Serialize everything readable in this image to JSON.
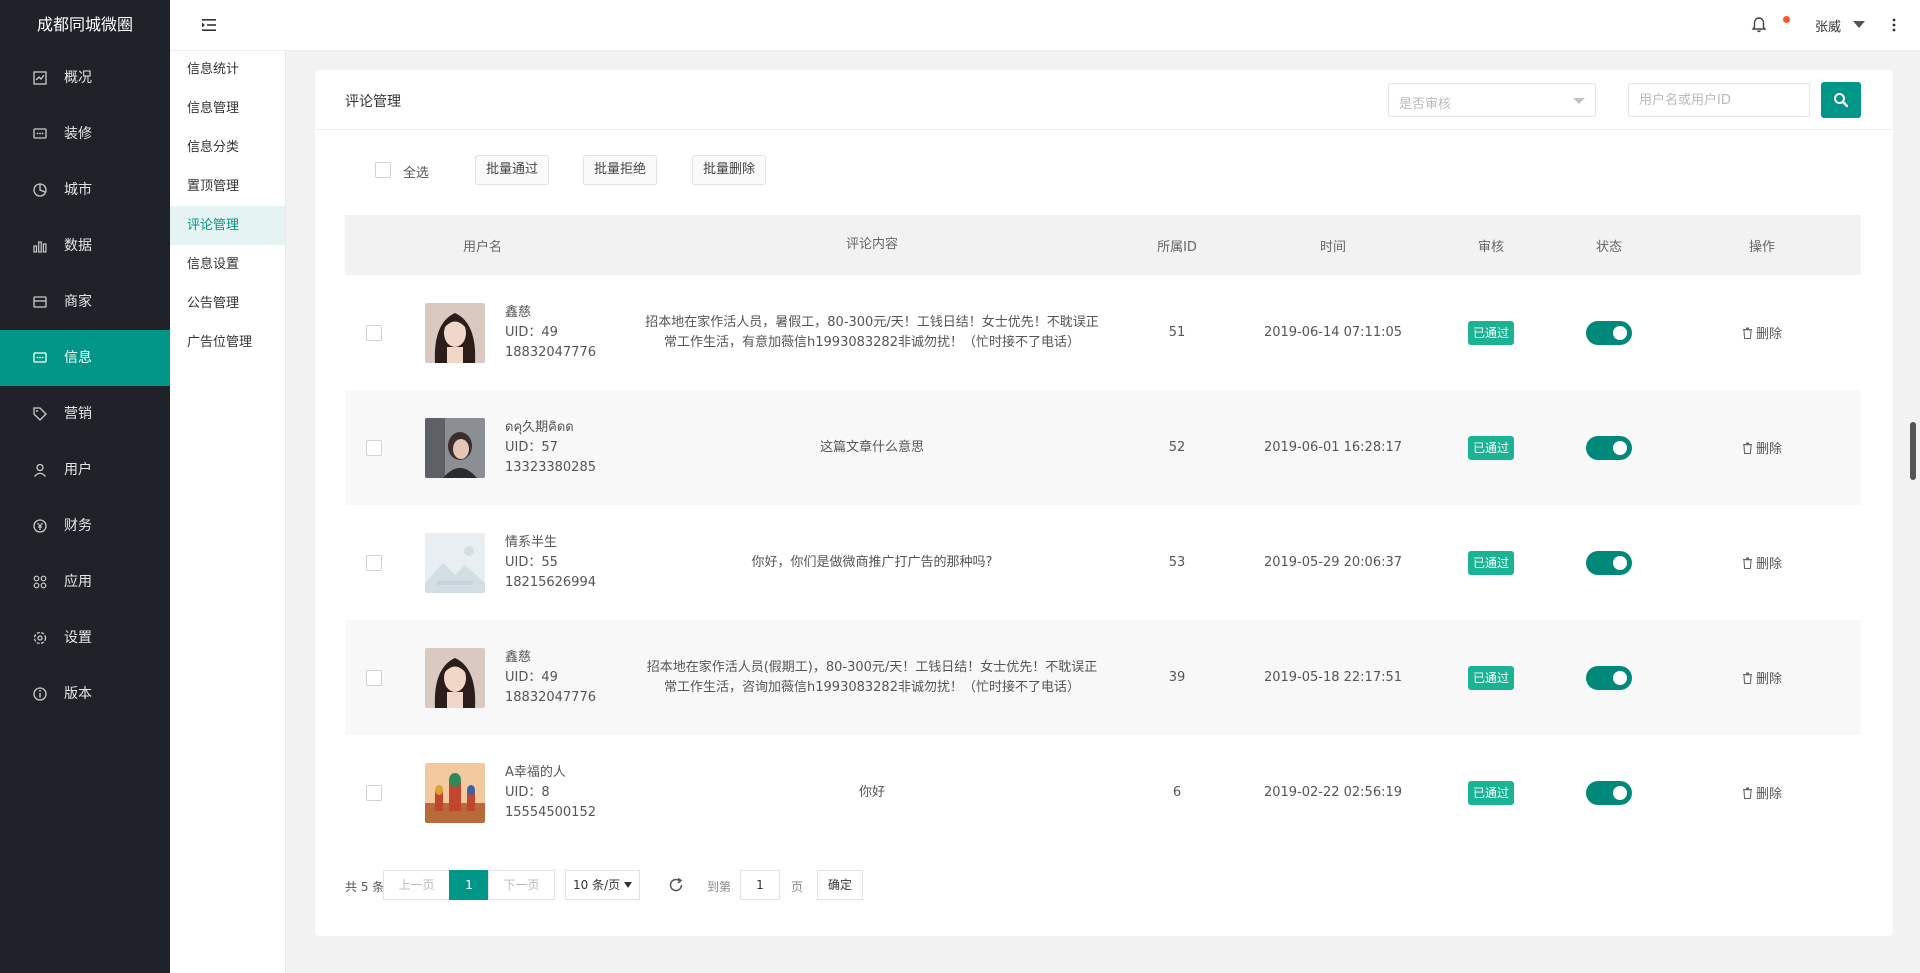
{
  "brand": "成都同城微圈",
  "nav": [
    {
      "label": "概况",
      "icon": "dashboard-icon"
    },
    {
      "label": "装修",
      "icon": "decorate-icon"
    },
    {
      "label": "城市",
      "icon": "city-icon"
    },
    {
      "label": "数据",
      "icon": "data-icon"
    },
    {
      "label": "商家",
      "icon": "merchant-icon"
    },
    {
      "label": "信息",
      "icon": "message-icon",
      "active": true
    },
    {
      "label": "营销",
      "icon": "tag-icon"
    },
    {
      "label": "用户",
      "icon": "user-icon"
    },
    {
      "label": "财务",
      "icon": "finance-icon"
    },
    {
      "label": "应用",
      "icon": "apps-icon"
    },
    {
      "label": "设置",
      "icon": "settings-icon"
    },
    {
      "label": "版本",
      "icon": "info-icon"
    }
  ],
  "submenu": [
    {
      "label": "信息统计"
    },
    {
      "label": "信息管理"
    },
    {
      "label": "信息分类"
    },
    {
      "label": "置顶管理"
    },
    {
      "label": "评论管理",
      "active": true
    },
    {
      "label": "信息设置"
    },
    {
      "label": "公告管理"
    },
    {
      "label": "广告位管理"
    }
  ],
  "header": {
    "username": "张威"
  },
  "card": {
    "title": "评论管理",
    "audit_placeholder": "是否审核",
    "search_placeholder": "用户名或用户ID"
  },
  "toolbar": {
    "select_all": "全选",
    "batch_pass": "批量通过",
    "batch_reject": "批量拒绝",
    "batch_delete": "批量删除"
  },
  "table": {
    "columns": {
      "username": "用户名",
      "content": "评论内容",
      "belong_id": "所属ID",
      "time": "时间",
      "audit": "审核",
      "status": "状态",
      "op": "操作"
    },
    "rows": [
      {
        "name": "鑫慈",
        "uid": "UID：49",
        "phone": "18832047776",
        "content": "招本地在家作活人员，暑假工，80-300元/天！工钱日结！女士优先！不耽误正常工作生活，有意加薇信h1993083282非诚勿扰！（忙时接不了电话）",
        "belong_id": "51",
        "time": "2019-06-14 07:11:05",
        "audit": "已通过",
        "delete": "删除",
        "avatar": "woman"
      },
      {
        "name": "ดคุ久期คิดด",
        "uid": "UID：57",
        "phone": "13323380285",
        "content": "这篇文章什么意思",
        "belong_id": "52",
        "time": "2019-06-01 16:28:17",
        "audit": "已通过",
        "delete": "删除",
        "avatar": "girl"
      },
      {
        "name": "情系半生",
        "uid": "UID：55",
        "phone": "18215626994",
        "content": "你好，你们是做微商推广打广告的那种吗?",
        "belong_id": "53",
        "time": "2019-05-29 20:06:37",
        "audit": "已通过",
        "delete": "删除",
        "avatar": "placeholder"
      },
      {
        "name": "鑫慈",
        "uid": "UID：49",
        "phone": "18832047776",
        "content": "招本地在家作活人员(假期工)，80-300元/天！工钱日结！女士优先！不耽误正常工作生活，咨询加薇信h1993083282非诚勿扰！（忙时接不了电话）",
        "belong_id": "39",
        "time": "2019-05-18 22:17:51",
        "audit": "已通过",
        "delete": "删除",
        "avatar": "woman"
      },
      {
        "name": "A幸福的人",
        "uid": "UID：8",
        "phone": "15554500152",
        "content": "你好",
        "belong_id": "6",
        "time": "2019-02-22 02:56:19",
        "audit": "已通过",
        "delete": "删除",
        "avatar": "church"
      }
    ]
  },
  "pager": {
    "total": "共 5 条",
    "prev": "上一页",
    "current": "1",
    "next": "下一页",
    "page_size": "10 条/页",
    "goto": "到第",
    "goto_value": "1",
    "page_unit": "页",
    "confirm": "确定"
  }
}
